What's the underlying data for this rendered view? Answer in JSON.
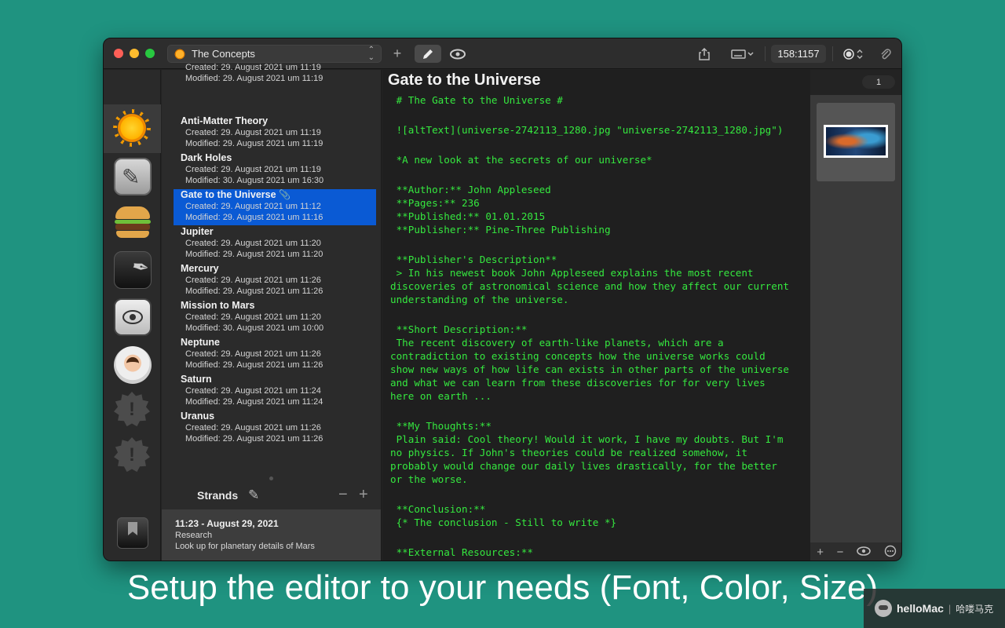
{
  "window": {
    "document_name": "The Concepts",
    "counter": "158:1157",
    "page_count": "1"
  },
  "list": {
    "items": [
      {
        "title": "",
        "created": "Created: 29. August 2021 um 11:19",
        "modified": "Modified: 29. August 2021 um 11:19"
      },
      {
        "title": "Anti-Matter Theory",
        "created": "Created: 29. August 2021 um 11:19",
        "modified": "Modified: 29. August 2021 um 11:19"
      },
      {
        "title": "Dark Holes",
        "created": "Created: 29. August 2021 um 11:19",
        "modified": "Modified: 30. August 2021 um 16:30"
      },
      {
        "title": "Gate to the Universe",
        "created": "Created: 29. August 2021 um 11:12",
        "modified": "Modified: 29. August 2021 um 11:16"
      },
      {
        "title": "Jupiter",
        "created": "Created: 29. August 2021 um 11:20",
        "modified": "Modified: 29. August 2021 um 11:20"
      },
      {
        "title": "Mercury",
        "created": "Created: 29. August 2021 um 11:26",
        "modified": "Modified: 29. August 2021 um 11:26"
      },
      {
        "title": "Mission to Mars",
        "created": "Created: 29. August 2021 um 11:20",
        "modified": "Modified: 30. August 2021 um 10:00"
      },
      {
        "title": "Neptune",
        "created": "Created: 29. August 2021 um 11:26",
        "modified": "Modified: 29. August 2021 um 11:26"
      },
      {
        "title": "Saturn",
        "created": "Created: 29. August 2021 um 11:24",
        "modified": "Modified: 29. August 2021 um 11:24"
      },
      {
        "title": "Uranus",
        "created": "Created: 29. August 2021 um 11:26",
        "modified": "Modified: 29. August 2021 um 11:26"
      }
    ],
    "selected_index": 3
  },
  "strands": {
    "label": "Strands",
    "entry": {
      "time": "11:23 - August 29, 2021",
      "category": "Research",
      "text": "Look up for planetary details of Mars"
    }
  },
  "editor": {
    "title": "Gate to the Universe",
    "lines": [
      " # The Gate to the Universe #",
      "",
      " ![altText](universe-2742113_1280.jpg \"universe-2742113_1280.jpg\")",
      "",
      " *A new look at the secrets of our universe*",
      "",
      " **Author:** John Appleseed",
      " **Pages:** 236",
      " **Published:** 01.01.2015",
      " **Publisher:** Pine-Three Publishing",
      "",
      " **Publisher's Description**",
      " > In his newest book John Appleseed explains the most recent",
      "discoveries of astronomical science and how they affect our current",
      "understanding of the universe.",
      "",
      " **Short Description:**",
      " The recent discovery of earth-like planets, which are a",
      "contradiction to existing concepts how the universe works could",
      "show new ways of how life can exists in other parts of the universe",
      "and what we can learn from these discoveries for for very lives",
      "here on earth ...",
      "",
      " **My Thoughts:**",
      " Plain said: Cool theory! Would it work, I have my doubts. But I'm",
      "no physics. If John's theories could be realized somehow, it",
      "probably would change our daily lives drastically, for the better",
      "or the worse.",
      "",
      " **Conclusion:**",
      " {* The conclusion - Still to write *}",
      "",
      " **External Resources:**"
    ]
  },
  "caption": "Setup the editor to your needs (Font, Color, Size)",
  "watermark": {
    "brand": "helloMac",
    "cn": "哈喽马克"
  },
  "colors": {
    "background": "#1f9380",
    "editor_text": "#35e83f",
    "selection": "#0a5ad4"
  }
}
